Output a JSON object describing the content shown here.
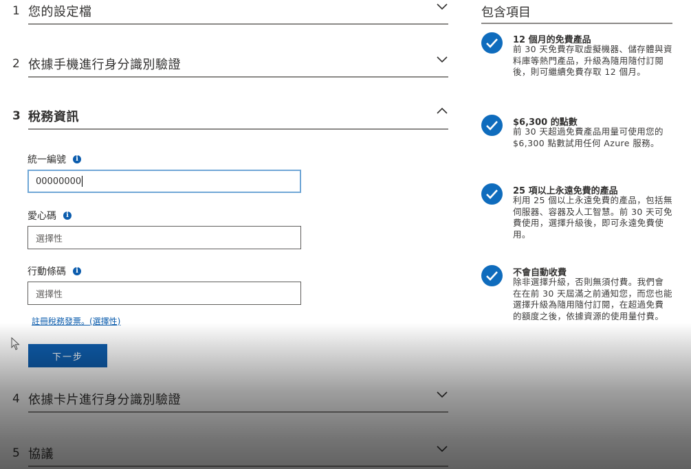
{
  "steps": [
    {
      "num": "1",
      "title": "您的設定檔"
    },
    {
      "num": "2",
      "title": "依據手機進行身分識別驗證"
    },
    {
      "num": "3",
      "title": "稅務資訊"
    },
    {
      "num": "4",
      "title": "依據卡片進行身分識別驗證"
    },
    {
      "num": "5",
      "title": "協議"
    }
  ],
  "form": {
    "tax_id_label": "統一編號",
    "tax_id_value": "00000000",
    "love_code_label": "愛心碼",
    "love_code_placeholder": "選擇性",
    "barcode_label": "行動條碼",
    "barcode_placeholder": "選擇性",
    "register_link": "註冊稅務發票。(選擇性)",
    "next_button": "下一步"
  },
  "included": {
    "title": "包含項目",
    "items": [
      {
        "title": "12 個月的免費產品",
        "desc": "前 30 天免費存取虛擬機器、儲存體與資料庫等熱門產品，升級為隨用隨付訂閱後，則可繼續免費存取 12 個月。"
      },
      {
        "title": "$6,300 的點數",
        "desc": "前 30 天超過免費產品用量可使用您的 $6,300 點數試用任何 Azure 服務。"
      },
      {
        "title": "25 項以上永遠免費的產品",
        "desc": "利用 25 個以上永遠免費的產品，包括無伺服器、容器及人工智慧。前 30 天可免費使用，選擇升級後，即可永遠免費使用。"
      },
      {
        "title": "不會自動收費",
        "desc": "除非選擇升級，否則無須付費。我們會在在前 30 天屆滿之前通知您，而您也能選擇升級為隨用隨付訂閱，在超過免費的額度之後，依據資源的使用量付費。"
      }
    ]
  },
  "icons": {
    "chevron_down": "chevron-down-icon",
    "chevron_up": "chevron-up-icon",
    "info": "info-icon",
    "check": "check-circle-icon",
    "pointer": "mouse-pointer-icon"
  },
  "colors": {
    "accent": "#0f6cbd",
    "button": "#0f5fb0",
    "link": "#0b5cad",
    "focus_border": "#6fa6d6"
  }
}
